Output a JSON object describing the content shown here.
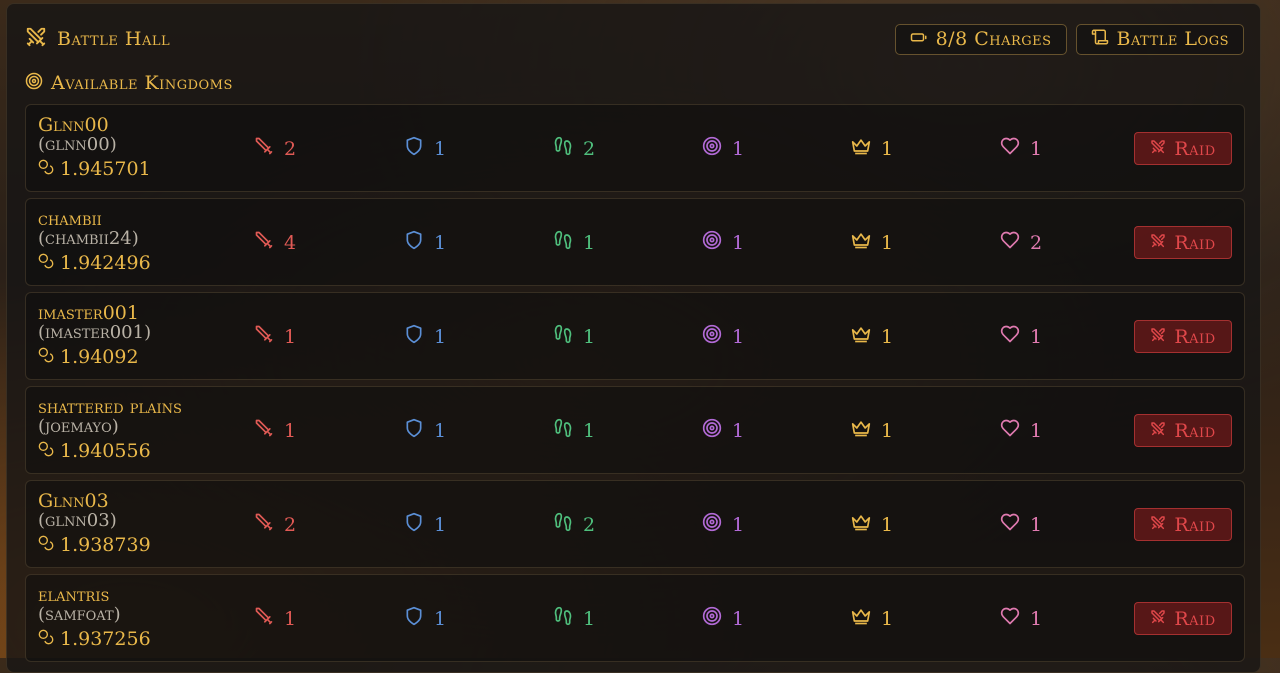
{
  "header": {
    "title": "Battle Hall",
    "charges_label": "8/8 Charges",
    "logs_label": "Battle Logs"
  },
  "section": {
    "title": "Available Kingdoms"
  },
  "raid_label": "Raid",
  "stat_colors": {
    "attack": "#e05a55",
    "defense": "#5b8fd6",
    "speed": "#4fbf7d",
    "accuracy": "#b26ad6",
    "crown": "#e9b84a",
    "health": "#e07ab0"
  },
  "kingdoms": [
    {
      "name": "Glnn00",
      "owner": "(glnn00)",
      "power": "1.945701",
      "attack": "2",
      "defense": "1",
      "speed": "2",
      "accuracy": "1",
      "crown": "1",
      "health": "1"
    },
    {
      "name": "chambii",
      "owner": "(chambii24)",
      "power": "1.942496",
      "attack": "4",
      "defense": "1",
      "speed": "1",
      "accuracy": "1",
      "crown": "1",
      "health": "2"
    },
    {
      "name": "imaster001",
      "owner": "(imaster001)",
      "power": "1.94092",
      "attack": "1",
      "defense": "1",
      "speed": "1",
      "accuracy": "1",
      "crown": "1",
      "health": "1"
    },
    {
      "name": "shattered plains",
      "owner": "(joemayo)",
      "power": "1.940556",
      "attack": "1",
      "defense": "1",
      "speed": "1",
      "accuracy": "1",
      "crown": "1",
      "health": "1"
    },
    {
      "name": "Glnn03",
      "owner": "(glnn03)",
      "power": "1.938739",
      "attack": "2",
      "defense": "1",
      "speed": "2",
      "accuracy": "1",
      "crown": "1",
      "health": "1"
    },
    {
      "name": "elantris",
      "owner": "(samfoat)",
      "power": "1.937256",
      "attack": "1",
      "defense": "1",
      "speed": "1",
      "accuracy": "1",
      "crown": "1",
      "health": "1"
    }
  ]
}
